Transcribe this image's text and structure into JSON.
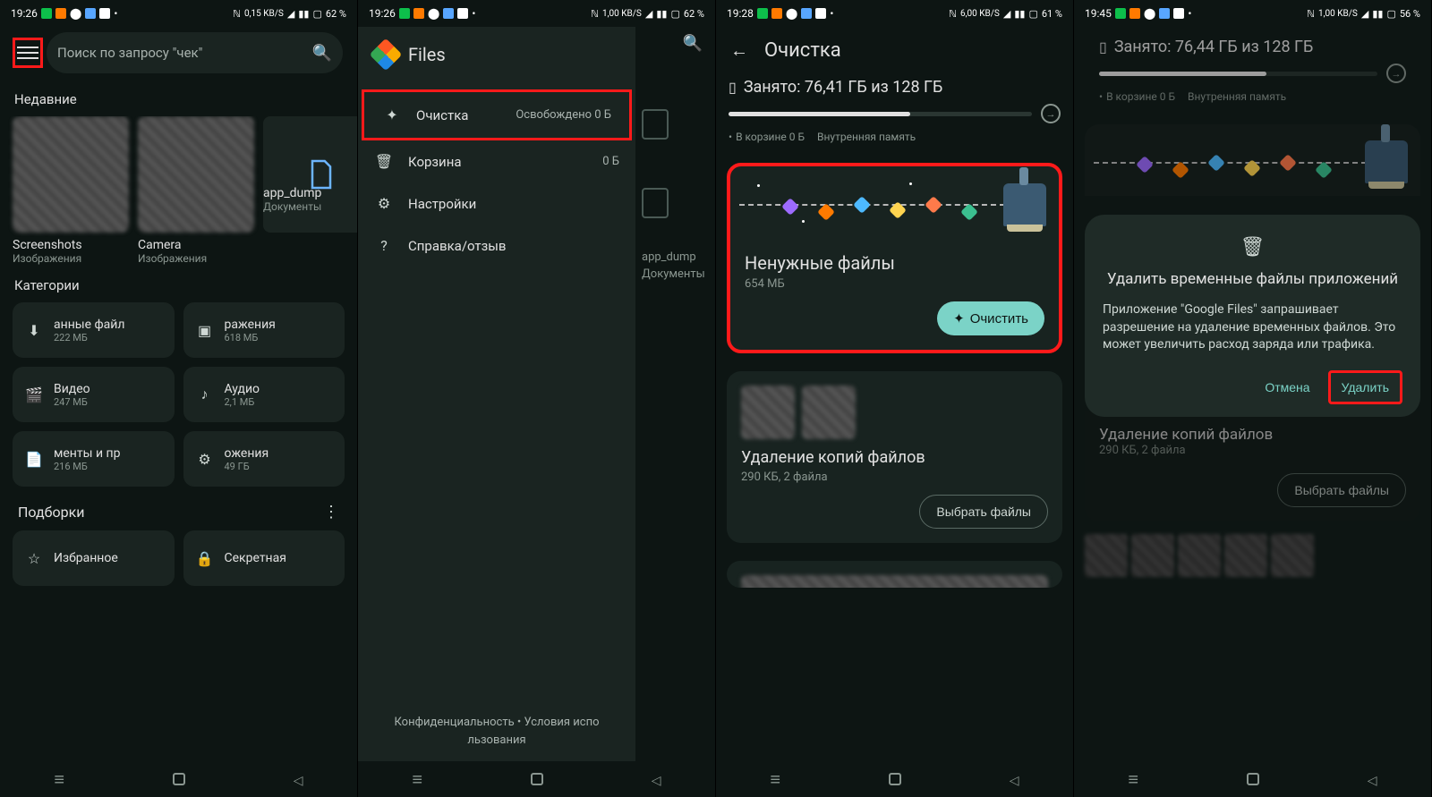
{
  "status": {
    "t1": "19:26",
    "t2": "19:26",
    "t3": "19:28",
    "t4": "19:45",
    "rate1": "0,15 KB/S",
    "rate2": "1,00 KB/S",
    "rate3": "6,00 KB/S",
    "rate4": "1,00 KB/S",
    "batt1": "62 %",
    "batt2": "62 %",
    "batt3": "61 %",
    "batt4": "56 %"
  },
  "s1": {
    "search_placeholder": "Поиск по запросу \"чек\"",
    "recent_title": "Недавние",
    "recent": [
      {
        "label": "Screenshots",
        "sub": "Изображения"
      },
      {
        "label": "Camera",
        "sub": "Изображения"
      },
      {
        "label": "app_dump",
        "sub": "Документы"
      }
    ],
    "categories_title": "Категории",
    "cats": [
      {
        "icon": "⬇",
        "t": "анные файл",
        "s": "222 МБ"
      },
      {
        "icon": "▣",
        "t": "ражения",
        "s": "618 МБ"
      },
      {
        "icon": "🎬",
        "t": "Видео",
        "s": "247 МБ"
      },
      {
        "icon": "♪",
        "t": "Аудио",
        "s": "2,1 МБ"
      },
      {
        "icon": "📄",
        "t": "менты и пр",
        "s": "216 МБ"
      },
      {
        "icon": "⚙",
        "t": "ожения",
        "s": "49 ГБ"
      }
    ],
    "collections_title": "Подборки",
    "coll": [
      {
        "icon": "☆",
        "t": "Избранное"
      },
      {
        "icon": "🔒",
        "t": "Секретная"
      }
    ]
  },
  "s2": {
    "app_name": "Files",
    "items": [
      {
        "icon": "✦",
        "label": "Очистка",
        "val": "Освобождено 0 Б"
      },
      {
        "icon": "🗑",
        "label": "Корзина",
        "val": "0 Б"
      },
      {
        "icon": "⚙",
        "label": "Настройки",
        "val": ""
      },
      {
        "icon": "?",
        "label": "Справка/отзыв",
        "val": ""
      }
    ],
    "footer": "Конфиденциальность  •  Условия испо льзования",
    "dim_label": "app_dump",
    "dim_sub": "Документы"
  },
  "s3": {
    "title": "Очистка",
    "storage": "Занято: 76,41 ГБ из 128 ГБ",
    "progress_pct": 60,
    "trash": "В корзине 0 Б",
    "mem": "Внутренняя память",
    "junk_title": "Ненужные файлы",
    "junk_size": "654 МБ",
    "clean_btn": "Очистить",
    "dup_title": "Удаление копий файлов",
    "dup_sub": "290 КБ, 2 файла",
    "select_btn": "Выбрать файлы"
  },
  "s4": {
    "storage": "Занято: 76,44 ГБ из 128 ГБ",
    "progress_pct": 60,
    "trash": "В корзине 0 Б",
    "mem": "Внутренняя память",
    "hidden_title": "Удаление копий файлов",
    "hidden_sub": "290 КБ, 2 файла",
    "select_btn": "Выбрать файлы",
    "dialog_title": "Удалить временные файлы приложений",
    "dialog_body": "Приложение \"Google Files\" запрашивает разрешение на удаление временных файлов. Это может увеличить расход заряда или трафика.",
    "cancel": "Отмена",
    "delete": "Удалить"
  }
}
